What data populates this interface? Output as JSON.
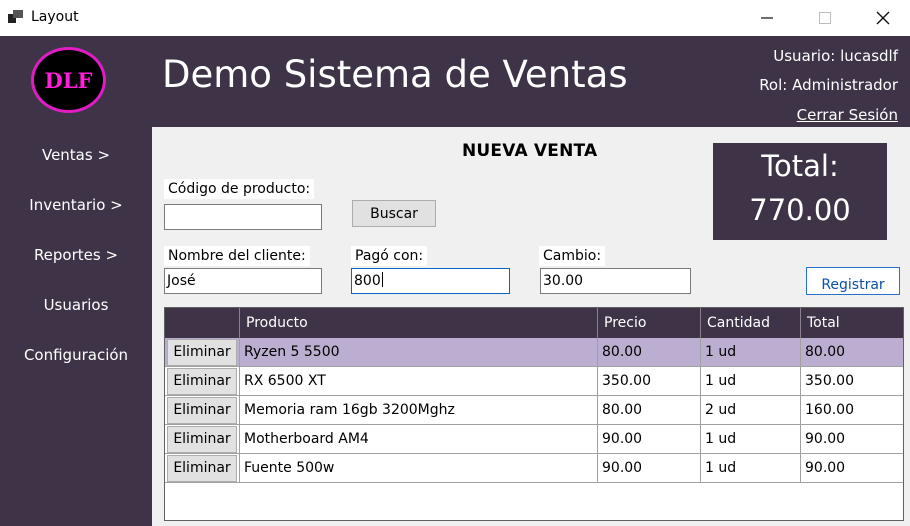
{
  "window": {
    "title": "Layout",
    "icon": "app-window-icon",
    "controls": {
      "minimize": "—",
      "maximize": "☐",
      "close": "✕"
    }
  },
  "header": {
    "logo_text": "DLF",
    "app_title": "Demo Sistema de Ventas",
    "user_label": "Usuario: lucasdlf",
    "role_label": "Rol: Administrador",
    "logout_label": "Cerrar Sesión"
  },
  "sidebar": {
    "items": [
      {
        "label": "Ventas >"
      },
      {
        "label": "Inventario >"
      },
      {
        "label": "Reportes >"
      },
      {
        "label": "Usuarios"
      },
      {
        "label": "Configuración"
      }
    ]
  },
  "sale": {
    "section_title": "NUEVA VENTA",
    "total_label": "Total:",
    "total_value": "770.00",
    "product_code_label": "Código de producto:",
    "product_code_value": "",
    "search_button": "Buscar",
    "client_label": "Nombre del cliente:",
    "client_value": "José",
    "paid_label": "Pagó con:",
    "paid_value": "800",
    "change_label": "Cambio:",
    "change_value": "30.00",
    "register_button": "Registrar"
  },
  "grid": {
    "columns": [
      "",
      "Producto",
      "Precio",
      "Cantidad",
      "Total"
    ],
    "delete_label": "Eliminar",
    "rows": [
      {
        "product": "Ryzen 5 5500",
        "price": "80.00",
        "qty": "1 ud",
        "total": "80.00",
        "selected": true
      },
      {
        "product": "RX 6500 XT",
        "price": "350.00",
        "qty": "1 ud",
        "total": "350.00"
      },
      {
        "product": "Memoria ram 16gb 3200Mghz",
        "price": "80.00",
        "qty": "2 ud",
        "total": "160.00"
      },
      {
        "product": "Motherboard AM4",
        "price": "90.00",
        "qty": "1 ud",
        "total": "90.00"
      },
      {
        "product": "Fuente 500w",
        "price": "90.00",
        "qty": "1 ud",
        "total": "90.00"
      }
    ]
  },
  "colors": {
    "brand_dark": "#3f3447",
    "logo_magenta": "#ff20d8",
    "selected_row": "#bcaed0",
    "panel_bg": "#f0f0f0"
  }
}
